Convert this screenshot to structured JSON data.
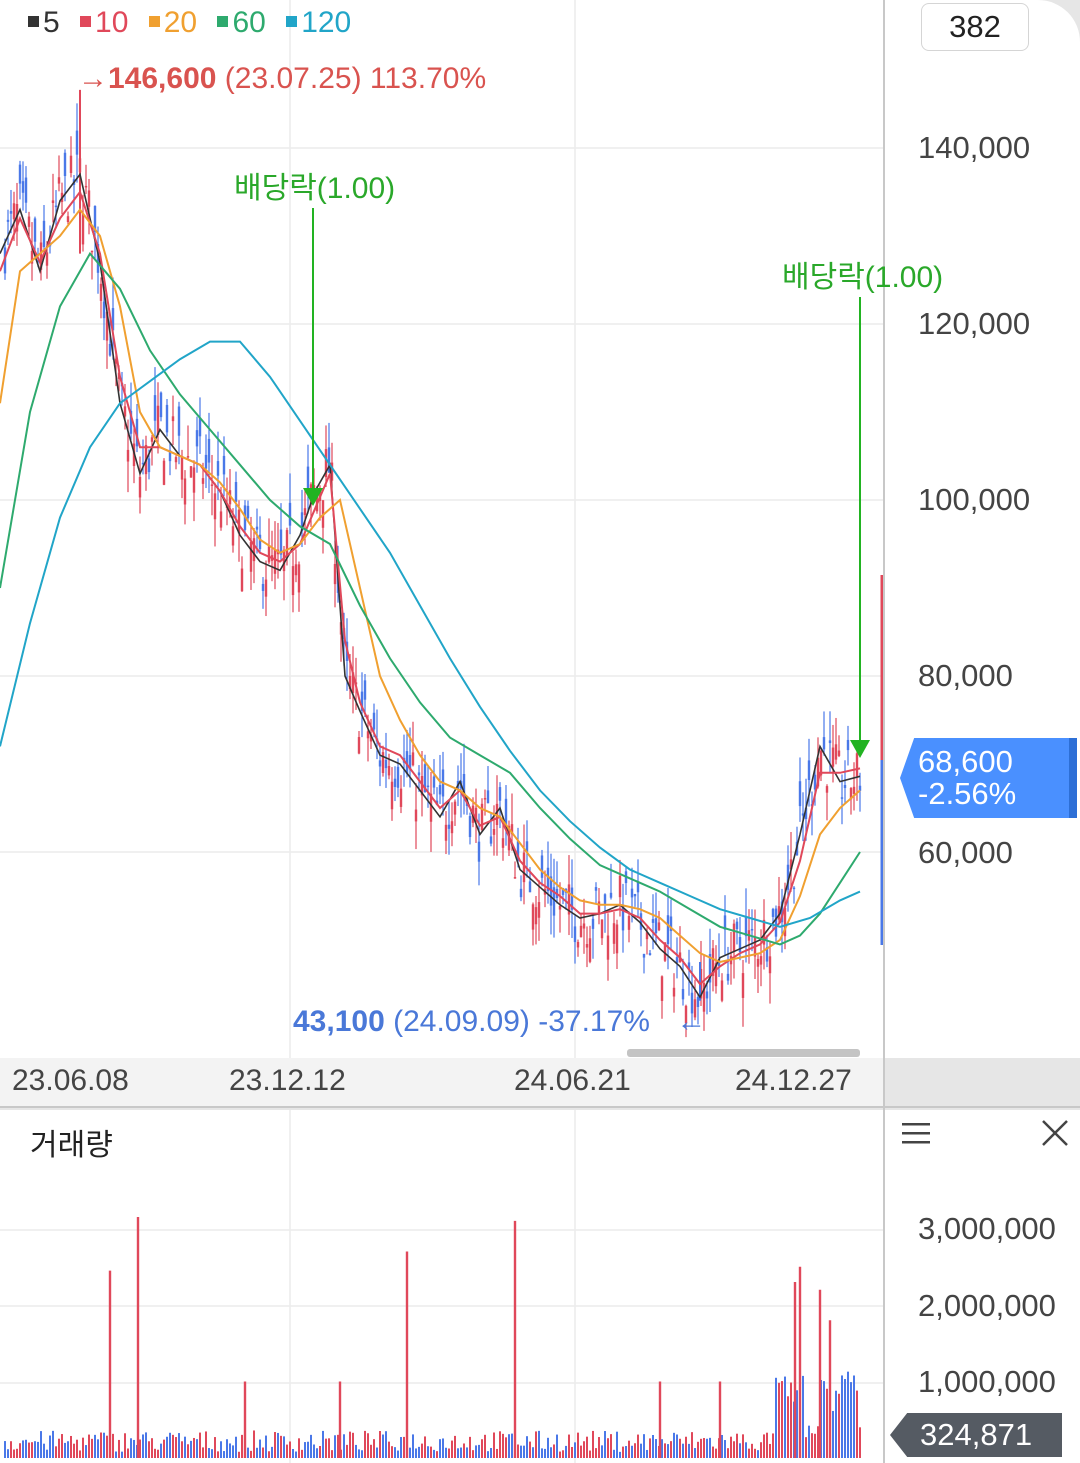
{
  "legend": [
    {
      "label": "5",
      "color": "#333333"
    },
    {
      "label": "10",
      "color": "#e0485a"
    },
    {
      "label": "20",
      "color": "#f0a030"
    },
    {
      "label": "60",
      "color": "#2eaa6e"
    },
    {
      "label": "120",
      "color": "#21a5c8"
    }
  ],
  "top_box_value": "382",
  "high_annotation": {
    "arrow": "→",
    "value": "146,600",
    "date": "(23.07.25)",
    "pct": "113.70%"
  },
  "low_annotation": {
    "value": "43,100",
    "date": "(24.09.09)",
    "pct": "-37.17%",
    "arrow": "←"
  },
  "dividend_label": "배당락(1.00)",
  "price_tag": {
    "price": "68,600",
    "change": "-2.56%"
  },
  "volume_title": "거래량",
  "volume_tag": "324,871",
  "colors": {
    "up": "#e0485a",
    "down": "#4a78e8",
    "accent": "#4a90ff",
    "green": "#22b322"
  },
  "chart_data": [
    {
      "type": "line",
      "title": "",
      "x_tick_labels": [
        "23.06.08",
        "23.12.12",
        "24.06.21",
        "24.12.27"
      ],
      "y_tick_labels": [
        "140,000",
        "120,000",
        "100,000",
        "80,000",
        "60,000"
      ],
      "ylim": [
        40000,
        155000
      ],
      "grid": true,
      "legend_placement": "top-left",
      "series": [
        {
          "name": "5",
          "anchors": [
            [
              0,
              128000
            ],
            [
              20,
              133000
            ],
            [
              40,
              126000
            ],
            [
              60,
              134000
            ],
            [
              80,
              137000
            ],
            [
              100,
              127000
            ],
            [
              120,
              111000
            ],
            [
              140,
              103000
            ],
            [
              160,
              108000
            ],
            [
              180,
              105000
            ],
            [
              200,
              104000
            ],
            [
              220,
              101000
            ],
            [
              240,
              96000
            ],
            [
              260,
              93000
            ],
            [
              280,
              92000
            ],
            [
              300,
              96000
            ],
            [
              315,
              101000
            ],
            [
              330,
              104000
            ],
            [
              345,
              80000
            ],
            [
              360,
              76000
            ],
            [
              380,
              71000
            ],
            [
              400,
              70000
            ],
            [
              420,
              67000
            ],
            [
              440,
              64000
            ],
            [
              460,
              68000
            ],
            [
              480,
              62000
            ],
            [
              500,
              65000
            ],
            [
              520,
              58000
            ],
            [
              540,
              56000
            ],
            [
              560,
              54000
            ],
            [
              580,
              52500
            ],
            [
              600,
              53000
            ],
            [
              620,
              54000
            ],
            [
              640,
              52000
            ],
            [
              660,
              49000
            ],
            [
              680,
              47000
            ],
            [
              700,
              43500
            ],
            [
              720,
              48000
            ],
            [
              740,
              49000
            ],
            [
              760,
              50000
            ],
            [
              780,
              53000
            ],
            [
              800,
              62000
            ],
            [
              820,
              72000
            ],
            [
              840,
              68000
            ],
            [
              860,
              68600
            ]
          ]
        },
        {
          "name": "10",
          "anchors": [
            [
              0,
              126000
            ],
            [
              20,
              132000
            ],
            [
              40,
              127000
            ],
            [
              60,
              132000
            ],
            [
              80,
              135000
            ],
            [
              100,
              128000
            ],
            [
              120,
              114000
            ],
            [
              140,
              106000
            ],
            [
              160,
              106000
            ],
            [
              180,
              105000
            ],
            [
              200,
              104000
            ],
            [
              220,
              101000
            ],
            [
              240,
              97000
            ],
            [
              260,
              94000
            ],
            [
              280,
              93000
            ],
            [
              300,
              95000
            ],
            [
              315,
              99000
            ],
            [
              330,
              103000
            ],
            [
              345,
              84000
            ],
            [
              360,
              77000
            ],
            [
              380,
              72000
            ],
            [
              400,
              71000
            ],
            [
              420,
              68000
            ],
            [
              440,
              65000
            ],
            [
              460,
              67000
            ],
            [
              480,
              63000
            ],
            [
              500,
              64000
            ],
            [
              520,
              59000
            ],
            [
              540,
              56500
            ],
            [
              560,
              55000
            ],
            [
              580,
              53000
            ],
            [
              600,
              53000
            ],
            [
              620,
              53500
            ],
            [
              640,
              52500
            ],
            [
              660,
              50000
            ],
            [
              680,
              48000
            ],
            [
              700,
              45000
            ],
            [
              720,
              47000
            ],
            [
              740,
              48500
            ],
            [
              760,
              49500
            ],
            [
              780,
              52000
            ],
            [
              800,
              59000
            ],
            [
              820,
              69000
            ],
            [
              840,
              69000
            ],
            [
              860,
              69500
            ]
          ]
        },
        {
          "name": "20",
          "anchors": [
            [
              0,
              111000
            ],
            [
              20,
              126000
            ],
            [
              40,
              128000
            ],
            [
              60,
              130000
            ],
            [
              80,
              133000
            ],
            [
              100,
              130000
            ],
            [
              120,
              122000
            ],
            [
              140,
              110000
            ],
            [
              160,
              106000
            ],
            [
              180,
              105000
            ],
            [
              200,
              104000
            ],
            [
              220,
              102000
            ],
            [
              240,
              99000
            ],
            [
              260,
              95500
            ],
            [
              280,
              94000
            ],
            [
              300,
              95000
            ],
            [
              320,
              98000
            ],
            [
              340,
              100000
            ],
            [
              360,
              90000
            ],
            [
              380,
              80000
            ],
            [
              400,
              75000
            ],
            [
              420,
              71000
            ],
            [
              440,
              68000
            ],
            [
              460,
              67000
            ],
            [
              480,
              65000
            ],
            [
              500,
              64000
            ],
            [
              520,
              61000
            ],
            [
              540,
              58000
            ],
            [
              560,
              56000
            ],
            [
              580,
              54500
            ],
            [
              600,
              54000
            ],
            [
              620,
              54000
            ],
            [
              640,
              53500
            ],
            [
              660,
              52500
            ],
            [
              680,
              50500
            ],
            [
              700,
              48500
            ],
            [
              720,
              47500
            ],
            [
              740,
              48000
            ],
            [
              760,
              48500
            ],
            [
              780,
              50000
            ],
            [
              800,
              55000
            ],
            [
              820,
              62000
            ],
            [
              840,
              65000
            ],
            [
              860,
              67000
            ]
          ]
        },
        {
          "name": "60",
          "anchors": [
            [
              0,
              90000
            ],
            [
              30,
              110000
            ],
            [
              60,
              122000
            ],
            [
              90,
              128000
            ],
            [
              120,
              124000
            ],
            [
              150,
              117000
            ],
            [
              180,
              112000
            ],
            [
              210,
              108000
            ],
            [
              240,
              104000
            ],
            [
              270,
              100000
            ],
            [
              300,
              97000
            ],
            [
              330,
              95000
            ],
            [
              360,
              88000
            ],
            [
              390,
              82000
            ],
            [
              420,
              77000
            ],
            [
              450,
              73000
            ],
            [
              480,
              71000
            ],
            [
              510,
              69000
            ],
            [
              540,
              65000
            ],
            [
              570,
              61500
            ],
            [
              600,
              58500
            ],
            [
              630,
              57000
            ],
            [
              660,
              55500
            ],
            [
              690,
              53500
            ],
            [
              720,
              51500
            ],
            [
              750,
              50500
            ],
            [
              780,
              49500
            ],
            [
              800,
              50500
            ],
            [
              820,
              53000
            ],
            [
              840,
              56500
            ],
            [
              860,
              60000
            ]
          ]
        },
        {
          "name": "120",
          "anchors": [
            [
              0,
              72000
            ],
            [
              30,
              86000
            ],
            [
              60,
              98000
            ],
            [
              90,
              106000
            ],
            [
              120,
              111000
            ],
            [
              150,
              113500
            ],
            [
              180,
              116000
            ],
            [
              210,
              118000
            ],
            [
              240,
              118000
            ],
            [
              270,
              114000
            ],
            [
              300,
              109000
            ],
            [
              330,
              104000
            ],
            [
              360,
              99000
            ],
            [
              390,
              94000
            ],
            [
              420,
              88000
            ],
            [
              450,
              82000
            ],
            [
              480,
              76500
            ],
            [
              510,
              71500
            ],
            [
              540,
              67000
            ],
            [
              570,
              63500
            ],
            [
              600,
              60500
            ],
            [
              630,
              58000
            ],
            [
              660,
              56500
            ],
            [
              690,
              55000
            ],
            [
              720,
              53500
            ],
            [
              750,
              52500
            ],
            [
              780,
              51500
            ],
            [
              810,
              52500
            ],
            [
              840,
              54500
            ],
            [
              860,
              55500
            ]
          ]
        }
      ],
      "annotations": [
        {
          "text": "146,600 (23.07.25) 113.70%",
          "x": 80,
          "y": 146600
        },
        {
          "text": "43,100 (24.09.09) -37.17%",
          "x": 700,
          "y": 43100
        },
        {
          "text": "배당락(1.00)",
          "x": 313,
          "y": 101000
        },
        {
          "text": "배당락(1.00)",
          "x": 860,
          "y": 68600
        }
      ]
    },
    {
      "type": "bar",
      "title": "거래량",
      "y_tick_labels": [
        "3,000,000",
        "2,000,000",
        "1,000,000"
      ],
      "ylim": [
        0,
        3700000
      ],
      "spikes": [
        [
          110,
          2450000
        ],
        [
          138,
          3150000
        ],
        [
          245,
          1000000
        ],
        [
          340,
          1000000
        ],
        [
          407,
          2700000
        ],
        [
          515,
          3100000
        ],
        [
          660,
          1000000
        ],
        [
          720,
          1000000
        ],
        [
          795,
          2300000
        ],
        [
          800,
          2500000
        ],
        [
          820,
          2200000
        ],
        [
          830,
          1800000
        ]
      ],
      "last_value": 324871
    }
  ]
}
